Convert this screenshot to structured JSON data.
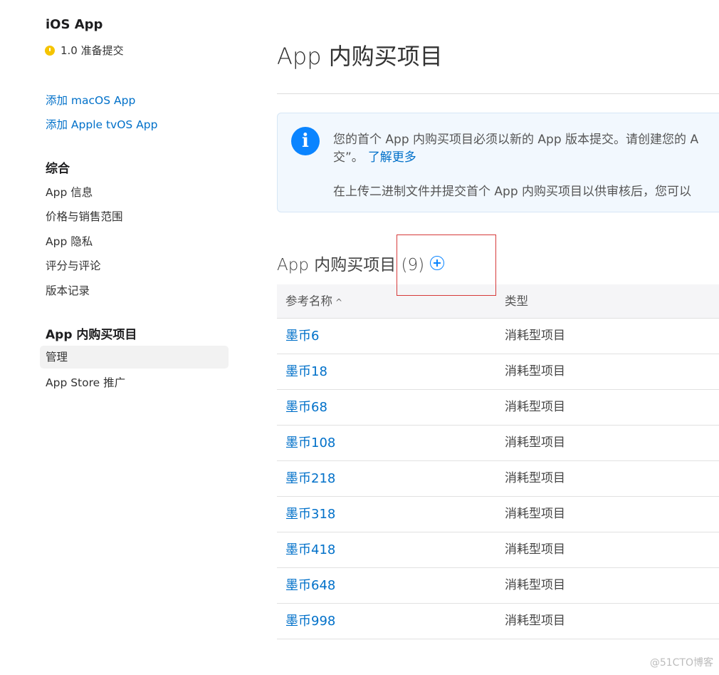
{
  "sidebar": {
    "app_title": "iOS App",
    "version": "1.0 准备提交",
    "add_links": [
      "添加 macOS App",
      "添加 Apple tvOS App"
    ],
    "general_heading": "综合",
    "general_items": [
      "App 信息",
      "价格与销售范围",
      "App 隐私",
      "评分与评论",
      "版本记录"
    ],
    "iap_heading": "App 内购买项目",
    "iap_items": [
      "管理",
      "App Store 推广"
    ]
  },
  "main": {
    "title": "App 内购买项目",
    "notice": {
      "line1": "您的首个 App 内购买项目必须以新的 App 版本提交。请创建您的 A",
      "line2": "交”。",
      "link": "了解更多",
      "line3": "在上传二进制文件并提交首个 App 内购买项目以供审核后，您可以"
    },
    "section_title": "App 内购买项目 (9)",
    "table": {
      "headers": [
        "参考名称",
        "类型"
      ],
      "sort_indicator": "^",
      "rows": [
        {
          "name": "墨币6",
          "type": "消耗型项目"
        },
        {
          "name": "墨币18",
          "type": "消耗型项目"
        },
        {
          "name": "墨币68",
          "type": "消耗型项目"
        },
        {
          "name": "墨币108",
          "type": "消耗型项目"
        },
        {
          "name": "墨币218",
          "type": "消耗型项目"
        },
        {
          "name": "墨币318",
          "type": "消耗型项目"
        },
        {
          "name": "墨币418",
          "type": "消耗型项目"
        },
        {
          "name": "墨币648",
          "type": "消耗型项目"
        },
        {
          "name": "墨币998",
          "type": "消耗型项目"
        }
      ]
    }
  },
  "watermark": "@51CTO博客",
  "colors": {
    "link": "#0070c9",
    "accent": "#0a84ff",
    "status": "#f5c400",
    "highlight": "#d63a3a"
  },
  "icons": {
    "status": "status-dot-icon",
    "info": "info-icon",
    "add": "add-circle-icon",
    "sort": "sort-ascending-icon"
  }
}
